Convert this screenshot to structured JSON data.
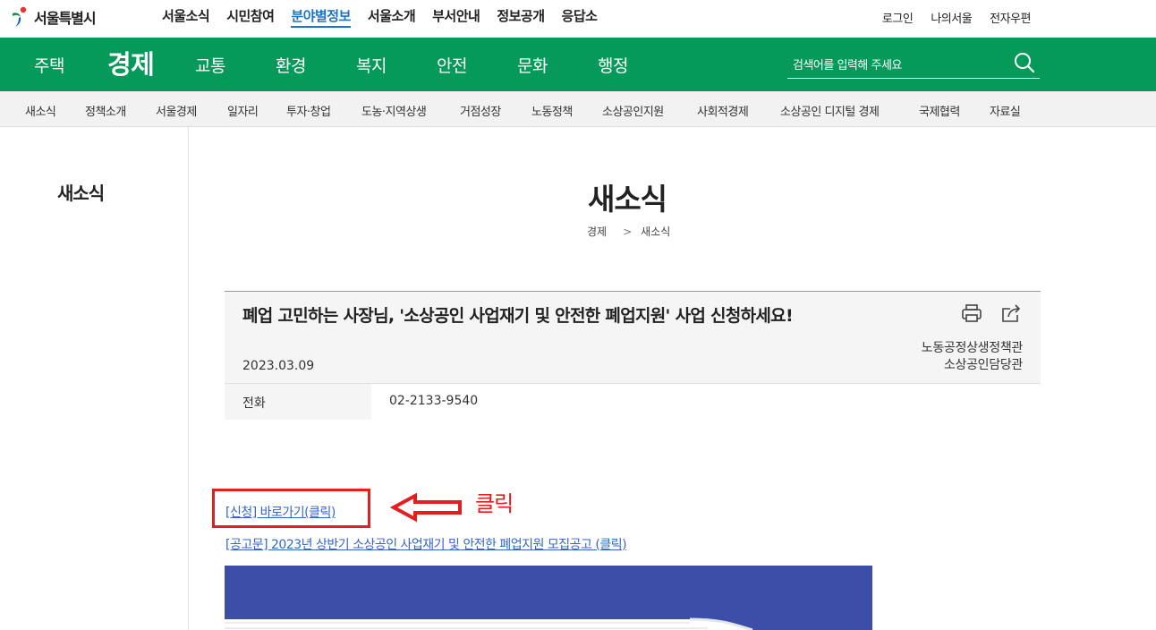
{
  "header": {
    "logo_text": "서울특별시",
    "gnb": [
      "서울소식",
      "시민참여",
      "분야별정보",
      "서울소개",
      "부서안내",
      "정보공개",
      "응답소"
    ],
    "gnb_active_index": 2,
    "util": [
      "로그인",
      "나의서울",
      "전자우편"
    ]
  },
  "green_nav": {
    "categories": [
      "주택",
      "경제",
      "교통",
      "환경",
      "복지",
      "안전",
      "문화",
      "행정"
    ],
    "active": "경제",
    "search_placeholder": "검색어를 입력해 주세요"
  },
  "sub_nav": {
    "items": [
      "새소식",
      "정책소개",
      "서울경제",
      "일자리",
      "투자·창업",
      "도농·지역상생",
      "거점성장",
      "노동정책",
      "소상공인지원",
      "사회적경제",
      "소상공인 디지털 경제",
      "국제협력",
      "자료실"
    ]
  },
  "sidebar": {
    "title": "새소식"
  },
  "page": {
    "title": "새소식",
    "breadcrumb": [
      "경제",
      "새소식"
    ]
  },
  "article": {
    "title": "폐업 고민하는 사장님, '소상공인 사업재기 및 안전한 폐업지원' 사업 신청하세요!",
    "date": "2023.03.09",
    "dept_line1": "노동공정상생정책관",
    "dept_line2": "소상공인담당관",
    "phone_label": "전화",
    "phone_value": "02-2133-9540"
  },
  "links": {
    "apply": "[신청] 바로가기(클릭)",
    "notice": "[공고문] 2023년 상반기 소상공인 사업재기 및 안전한 폐업지원 모집공고 (클릭)"
  },
  "annotation": {
    "label": "클릭",
    "color": "#e41e1e"
  },
  "colors": {
    "green": "#069a5a",
    "link": "#3366cc",
    "active_gnb": "#1a75c9"
  }
}
